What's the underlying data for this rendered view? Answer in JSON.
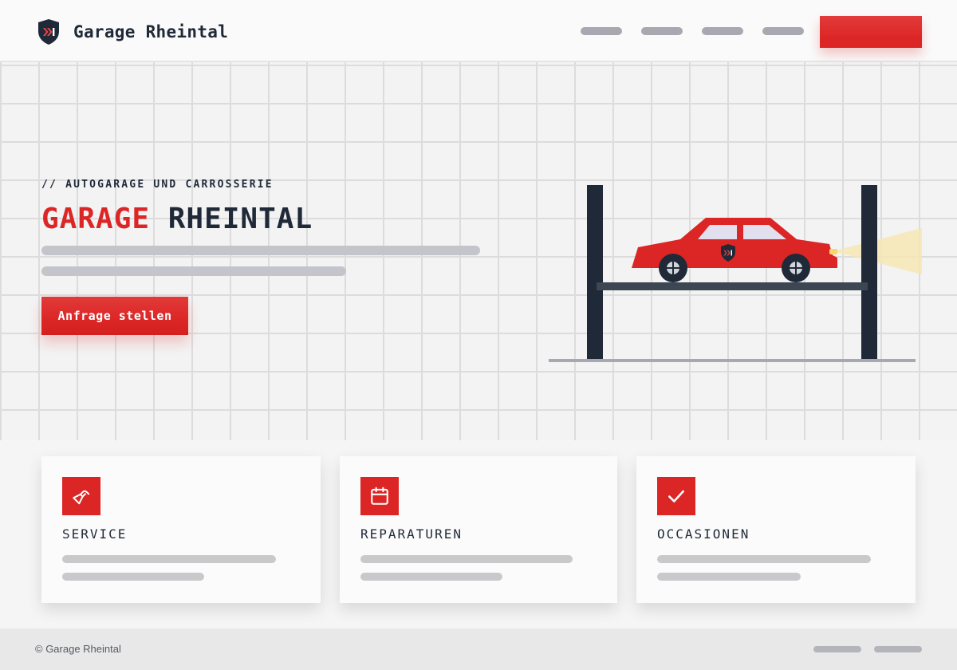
{
  "header": {
    "brand_name": "Garage Rheintal",
    "logo_icon": "shield-chevron-logo-icon",
    "nav_items": [
      "",
      "",
      "",
      ""
    ],
    "cta_label": ""
  },
  "hero": {
    "eyebrow": "// AUTOGARAGE UND CARROSSERIE",
    "title_accent": "GARAGE",
    "title_rest": "RHEINTAL",
    "cta_label": "Anfrage stellen",
    "illustration": "car-on-lift-illustration"
  },
  "services": [
    {
      "title": "SERVICE",
      "icon": "wrench-icon"
    },
    {
      "title": "REPARATUREN",
      "icon": "calendar-icon"
    },
    {
      "title": "OCCASIONEN",
      "icon": "check-icon"
    }
  ],
  "footer": {
    "copyright": "© Garage Rheintal"
  },
  "colors": {
    "accent": "#dc2626",
    "dark": "#1f2937",
    "background": "#f5f5f5",
    "placeholder": "#c4c5ca"
  }
}
